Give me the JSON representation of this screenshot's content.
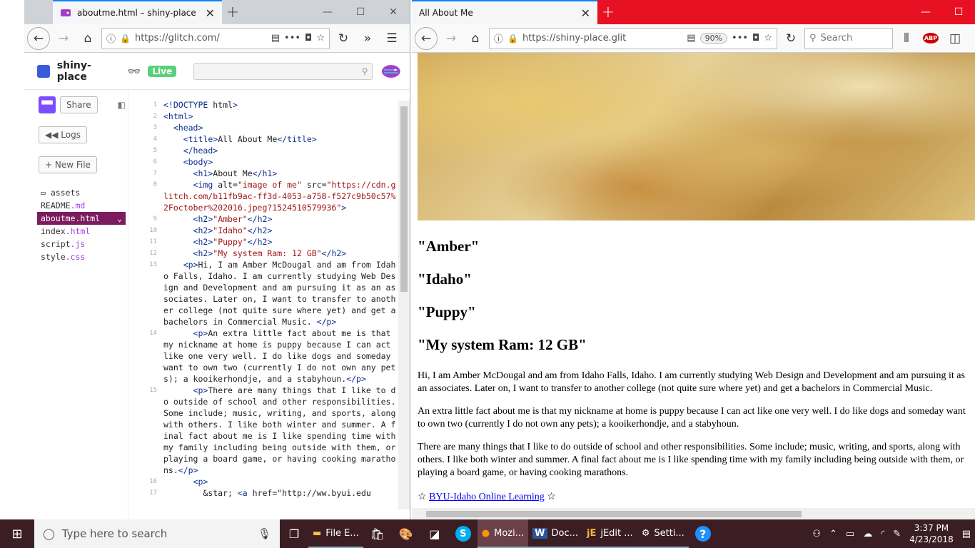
{
  "left_window": {
    "tab_title": "aboutme.html – shiny-place",
    "url": "https://glitch.com/",
    "glitch": {
      "project_name": "shiny-place",
      "live_badge": "Live",
      "share_label": "Share",
      "logs_label": "Logs",
      "new_file_label": "+ New File",
      "files": [
        {
          "name": "assets",
          "ext": ""
        },
        {
          "name": "README",
          "ext": ".md"
        },
        {
          "name": "aboutme",
          "ext": ".html"
        },
        {
          "name": "index",
          "ext": ".html"
        },
        {
          "name": "script",
          "ext": ".js"
        },
        {
          "name": "style",
          "ext": ".css"
        }
      ]
    },
    "code_lines": [
      {
        "n": "1",
        "t": "<!DOCTYPE html>"
      },
      {
        "n": "2",
        "t": "<html>"
      },
      {
        "n": "3",
        "t": "  <head>"
      },
      {
        "n": "4",
        "t": "    <title>All About Me</title>"
      },
      {
        "n": "5",
        "t": "    </head>"
      },
      {
        "n": "6",
        "t": "    <body>"
      },
      {
        "n": "7",
        "t": "      <h1>About Me</h1>"
      },
      {
        "n": "8",
        "t": "      <img alt=\"image of me\" src=\"https://cdn.glitch.com/b11fb9ac-ff3d-4053-a758-f527c9b50c57%2Foctober%202016.jpeg?1524510579936\">"
      },
      {
        "n": "9",
        "t": "      <h2>\"Amber\"</h2>"
      },
      {
        "n": "10",
        "t": "      <h2>\"Idaho\"</h2>"
      },
      {
        "n": "11",
        "t": "      <h2>\"Puppy\"</h2>"
      },
      {
        "n": "12",
        "t": "      <h2>\"My system Ram: 12 GB\"</h2>"
      },
      {
        "n": "13",
        "t": "    <p>Hi, I am Amber McDougal and am from Idaho Falls, Idaho. I am currently studying Web Design and Development and am pursuing it as an associates. Later on, I want to transfer to another college (not quite sure where yet) and get a bachelors in Commercial Music. </p>"
      },
      {
        "n": "14",
        "t": "      <p>An extra little fact about me is that my nickname at home is puppy because I can act like one very well. I do like dogs and someday want to own two (currently I do not own any pets); a kooikerhondje, and a stabyhoun.</p>"
      },
      {
        "n": "15",
        "t": "      <p>There are many things that I like to do outside of school and other responsibilities. Some include; music, writing, and sports, along with others. I like both winter and summer. A final fact about me is I like spending time with my family including being outside with them, or playing a board game, or having cooking marathons.</p>"
      },
      {
        "n": "16",
        "t": "      <p>"
      },
      {
        "n": "17",
        "t": "        &star; <a href=\"http://ww.byui.edu"
      }
    ]
  },
  "right_window": {
    "tab_title": "All About Me",
    "url": "https://shiny-place.glit",
    "zoom": "90%",
    "search_placeholder": "Search",
    "page": {
      "h2": [
        "\"Amber\"",
        "\"Idaho\"",
        "\"Puppy\"",
        "\"My system Ram: 12 GB\""
      ],
      "p1": "Hi, I am Amber McDougal and am from Idaho Falls, Idaho. I am currently studying Web Design and Development and am pursuing it as an associates. Later on, I want to transfer to another college (not quite sure where yet) and get a bachelors in Commercial Music.",
      "p2": "An extra little fact about me is that my nickname at home is puppy because I can act like one very well. I do like dogs and someday want to own two (currently I do not own any pets); a kooikerhondje, and a stabyhoun.",
      "p3": "There are many things that I like to do outside of school and other responsibilities. Some include; music, writing, and sports, along with others. I like both winter and summer. A final fact about me is I like spending time with my family including being outside with them, or playing a board game, or having cooking marathons.",
      "star": "☆",
      "link_text": "BYU-Idaho Online Learning"
    }
  },
  "taskbar": {
    "search_placeholder": "Type here to search",
    "apps": [
      {
        "label": "File E...",
        "icon": "folder-icon"
      },
      {
        "label": "Mozi...",
        "icon": "firefox-icon"
      },
      {
        "label": "Doc...",
        "icon": "word-icon"
      },
      {
        "label": "jEdit ...",
        "icon": "jedit-icon"
      },
      {
        "label": "Setti...",
        "icon": "gear-icon"
      }
    ],
    "time": "3:37 PM",
    "date": "4/23/2018"
  }
}
